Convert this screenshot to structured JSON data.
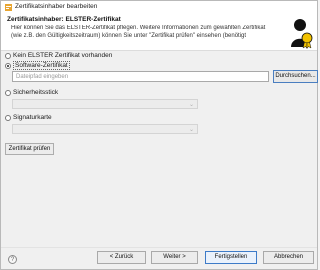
{
  "window": {
    "title": "Zertifikatsinhaber bearbeiten"
  },
  "header": {
    "title": "Zertifikatsinhaber: ELSTER-Zertifikat",
    "description_line1": "Hier können Sie das ELSTER-Zertifikat pflegen. Weitere Informationen zum gewählten Zertifikat",
    "description_line2": "(wie z.B. den Gültigkeitszeitraum) können Sie unter \"Zertifikat prüfen\" einsehen (benötigt"
  },
  "options": {
    "none_label": "Kein ELSTER Zertifikat vorhanden",
    "software_label": "Software-Zertifikat",
    "stick_label": "Sicherheitsstick",
    "card_label": "Signaturkarte",
    "selected": "software"
  },
  "software": {
    "path_placeholder": "Dateipfad eingeben",
    "browse_label": "Durchsuchen..."
  },
  "buttons": {
    "check_label": "Zertifikat prüfen",
    "back_label": "< Zurück",
    "next_label": "Weiter >",
    "finish_label": "Fertigstellen",
    "cancel_label": "Abbrechen",
    "help_label": "?"
  }
}
